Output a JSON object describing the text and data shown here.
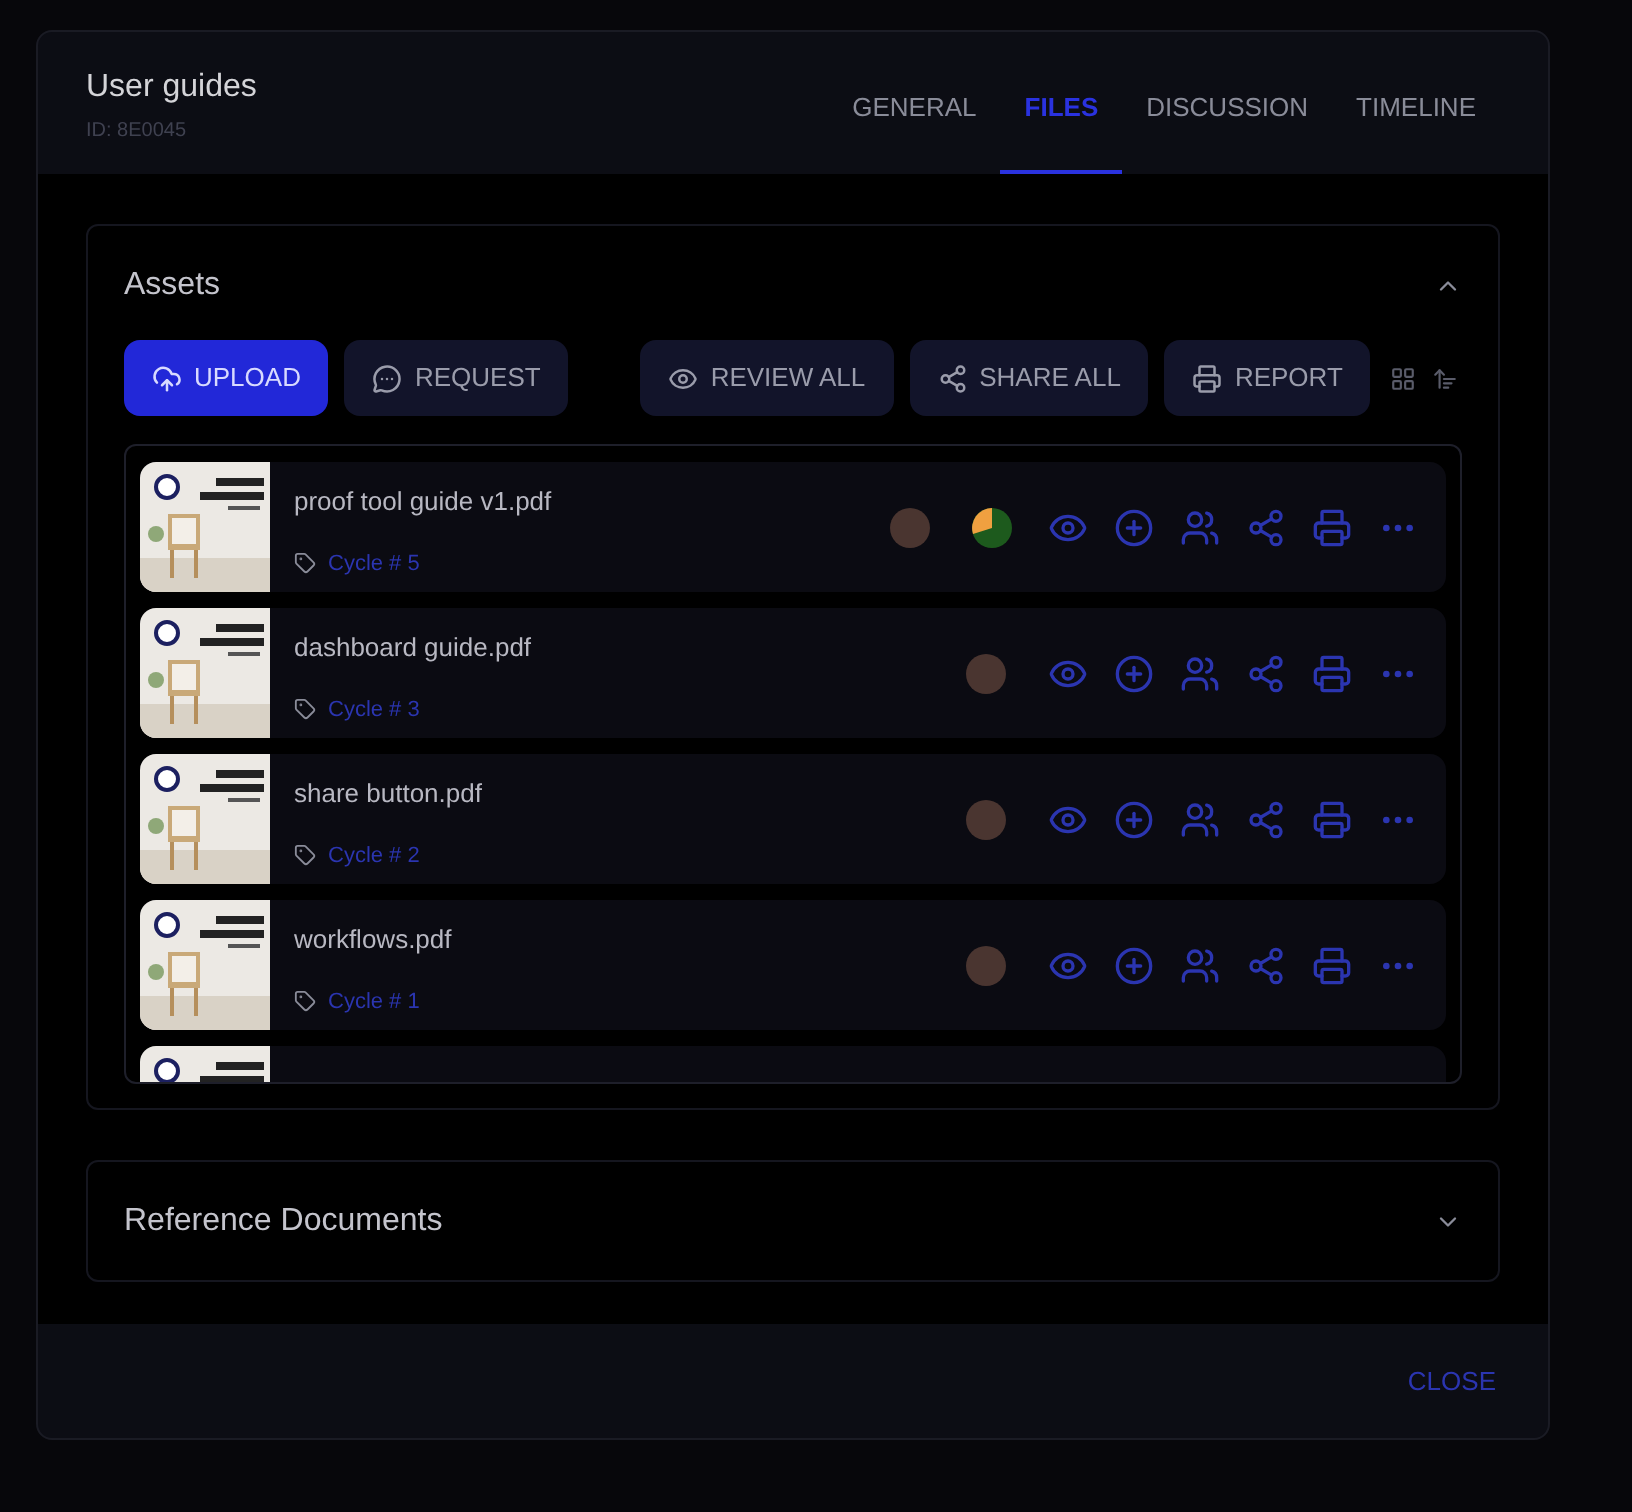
{
  "dialog": {
    "title": "User guides",
    "id_label": "ID: 8E0045"
  },
  "tabs": [
    {
      "label": "GENERAL",
      "selected": false
    },
    {
      "label": "FILES",
      "selected": true
    },
    {
      "label": "DISCUSSION",
      "selected": false
    },
    {
      "label": "TIMELINE",
      "selected": false
    }
  ],
  "assets": {
    "title": "Assets",
    "expanded": true,
    "buttons": [
      {
        "label": "UPLOAD",
        "kind": "upload",
        "primary": true
      },
      {
        "label": "REQUEST",
        "kind": "request",
        "primary": false
      },
      {
        "label": "REVIEW ALL",
        "kind": "review",
        "primary": false
      },
      {
        "label": "SHARE ALL",
        "kind": "share",
        "primary": false
      },
      {
        "label": "REPORT",
        "kind": "report",
        "primary": false
      }
    ],
    "files": [
      {
        "name": "proof tool guide v1.pdf",
        "cycle": "Cycle # 5",
        "selected": false,
        "progress": true
      },
      {
        "name": "dashboard guide.pdf",
        "cycle": "Cycle # 3",
        "selected": false,
        "progress": false
      },
      {
        "name": "share button.pdf",
        "cycle": "Cycle # 2",
        "selected": false,
        "progress": false
      },
      {
        "name": "workflows.pdf",
        "cycle": "Cycle # 1",
        "selected": false,
        "progress": false
      },
      {
        "selected": false
      }
    ]
  },
  "reference": {
    "title": "Reference Documents",
    "expanded": false
  },
  "footer": {
    "close": "CLOSE"
  }
}
